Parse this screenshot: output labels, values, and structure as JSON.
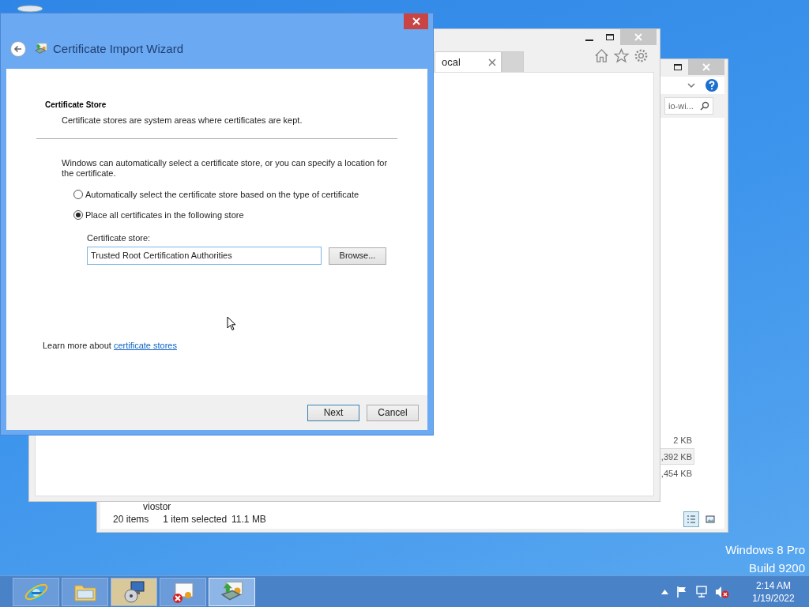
{
  "wizard": {
    "title": "Certificate Import Wizard",
    "heading": "Certificate Store",
    "subheading": "Certificate stores are system areas where certificates are kept.",
    "intro": "Windows can automatically select a certificate store, or you can specify a location for the certificate.",
    "options": [
      {
        "label": "Automatically select the certificate store based on the type of certificate",
        "selected": false
      },
      {
        "label": "Place all certificates in the following store",
        "selected": true
      }
    ],
    "store_label": "Certificate store:",
    "store_value": "Trusted Root Certification Authorities",
    "browse_button": "Browse...",
    "learn_more": {
      "text": "Learn more about",
      "link": "certificate stores"
    },
    "buttons": [
      {
        "label": "Next",
        "default": true
      },
      {
        "label": "Cancel",
        "default": false
      }
    ]
  },
  "browser": {
    "tab": "ocal"
  },
  "explorer": {
    "search": "io-wi...",
    "sizes": [
      {
        "text": "2 KB",
        "selected": false
      },
      {
        "text": ",392 KB",
        "selected": true
      },
      {
        "text": ",454 KB",
        "selected": false
      }
    ],
    "folder": "viostor",
    "status": {
      "items": "20 items",
      "selection": "1 item selected",
      "size": "11.1 MB"
    }
  },
  "desktop": {
    "edition": "Windows 8 Pro",
    "build": "Build 9200"
  },
  "taskbar": {
    "apps": [
      {
        "kind": "browser",
        "flashing": false,
        "selected": false
      },
      {
        "kind": "folder",
        "flashing": false,
        "selected": false
      },
      {
        "kind": "setup",
        "flashing": true,
        "selected": false
      },
      {
        "kind": "cert-error",
        "flashing": false,
        "selected": false
      },
      {
        "kind": "cert-import",
        "flashing": false,
        "selected": true
      }
    ],
    "time": "2:14 AM",
    "date": "1/19/2022"
  }
}
